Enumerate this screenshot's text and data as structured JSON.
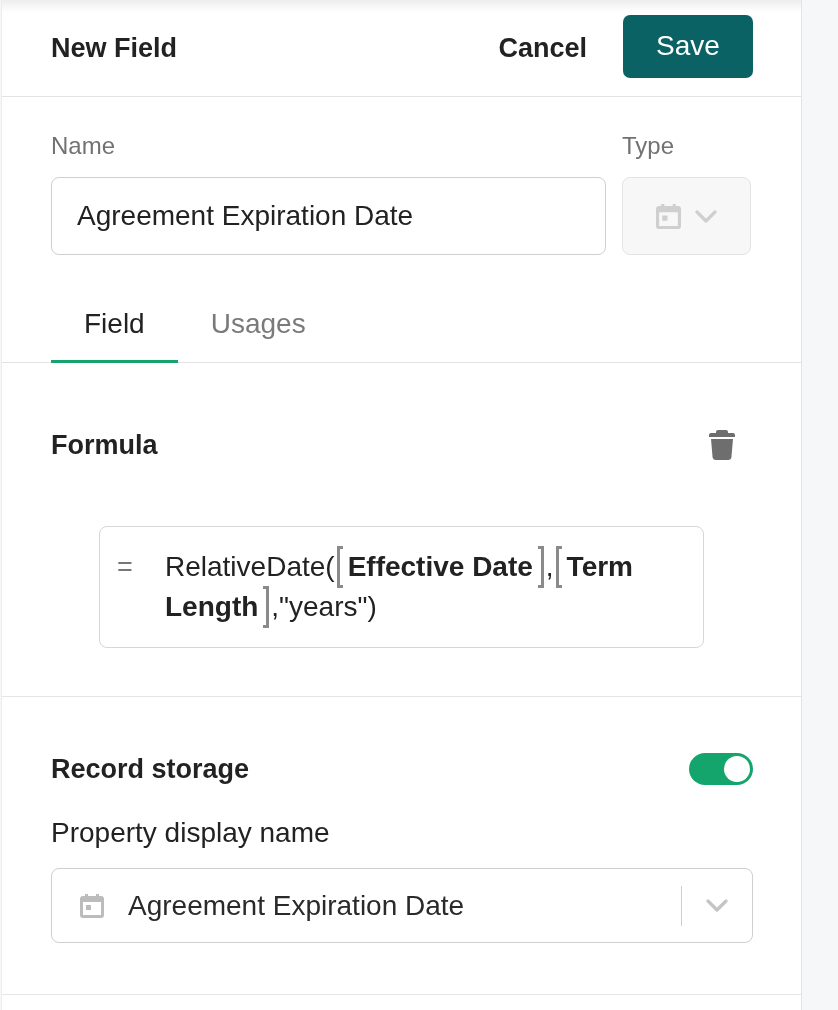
{
  "header": {
    "title": "New Field",
    "buttons": [
      {
        "label": "Cancel",
        "kind": "link"
      },
      {
        "label": "Save",
        "kind": "primary"
      }
    ]
  },
  "name_field": {
    "label": "Name",
    "value": "Agreement Expiration Date"
  },
  "type_field": {
    "label": "Type",
    "disabled": true
  },
  "tabs": [
    {
      "label": "Field",
      "selected": true
    },
    {
      "label": "Usages",
      "selected": false
    }
  ],
  "formula": {
    "title": "Formula",
    "operator": "=",
    "parts": [
      {
        "kind": "text",
        "text": "RelativeDate("
      },
      {
        "kind": "token",
        "text": "Effective Date"
      },
      {
        "kind": "text",
        "text": ","
      },
      {
        "kind": "token",
        "text": "Term Length"
      },
      {
        "kind": "text",
        "text": ",\"years\")"
      }
    ]
  },
  "record_storage": {
    "title": "Record storage",
    "on": true
  },
  "property_display_name": {
    "label": "Property display name",
    "value": "Agreement Expiration Date"
  }
}
